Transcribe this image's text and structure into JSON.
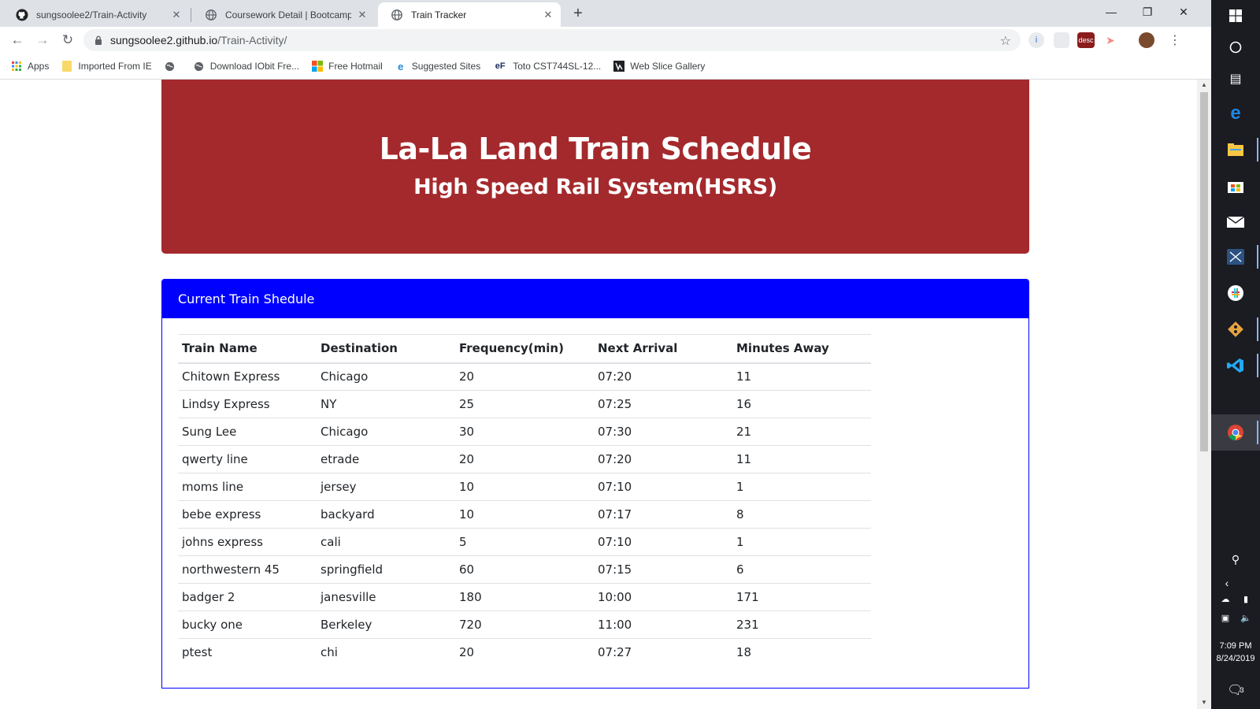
{
  "browser": {
    "tabs": [
      {
        "title": "sungsoolee2/Train-Activity",
        "icon": "github-icon",
        "active": false
      },
      {
        "title": "Coursework Detail | Bootcamp Sp",
        "icon": "globe-icon",
        "active": false
      },
      {
        "title": "Train Tracker",
        "icon": "globe-icon",
        "active": true
      }
    ],
    "new_tab_glyph": "+",
    "url_host": "sungsoolee2.github.io",
    "url_path": "/Train-Activity/",
    "bookmarks": [
      {
        "label": "Apps",
        "icon": "apps-grid-icon"
      },
      {
        "label": "Imported From IE",
        "icon": "folder-icon"
      },
      {
        "label": "",
        "icon": "globe-icon"
      },
      {
        "label": "Download IObit Fre...",
        "icon": "globe-icon"
      },
      {
        "label": "Free Hotmail",
        "icon": "windows-logo-icon"
      },
      {
        "label": "Suggested Sites",
        "icon": "ie-icon"
      },
      {
        "label": "Toto CST744SL-12...",
        "icon": "ef-logo-icon"
      },
      {
        "label": "Web Slice Gallery",
        "icon": "web-slice-icon"
      }
    ],
    "ext_label_desc": "desc"
  },
  "page": {
    "title": "La-La Land Train Schedule",
    "subtitle": "High Speed Rail System(HSRS)",
    "card_header": "Current Train Shedule",
    "columns": [
      "Train Name",
      "Destination",
      "Frequency(min)",
      "Next Arrival",
      "Minutes Away"
    ],
    "rows": [
      [
        "Chitown Express",
        "Chicago",
        "20",
        "07:20",
        "11"
      ],
      [
        "Lindsy Express",
        "NY",
        "25",
        "07:25",
        "16"
      ],
      [
        "Sung Lee",
        "Chicago",
        "30",
        "07:30",
        "21"
      ],
      [
        "qwerty line",
        "etrade",
        "20",
        "07:20",
        "11"
      ],
      [
        "moms line",
        "jersey",
        "10",
        "07:10",
        "1"
      ],
      [
        "bebe express",
        "backyard",
        "10",
        "07:17",
        "8"
      ],
      [
        "johns express",
        "cali",
        "5",
        "07:10",
        "1"
      ],
      [
        "northwestern 45",
        "springfield",
        "60",
        "07:15",
        "6"
      ],
      [
        "badger 2",
        "janesville",
        "180",
        "10:00",
        "171"
      ],
      [
        "bucky one",
        "Berkeley",
        "720",
        "11:00",
        "231"
      ],
      [
        "ptest",
        "chi",
        "20",
        "07:27",
        "18"
      ]
    ]
  },
  "taskbar": {
    "time": "7:09 PM",
    "date": "8/24/2019",
    "notification_count": "3"
  },
  "colors": {
    "jumbotron": "#a4292c",
    "card_header": "#0000ff"
  }
}
